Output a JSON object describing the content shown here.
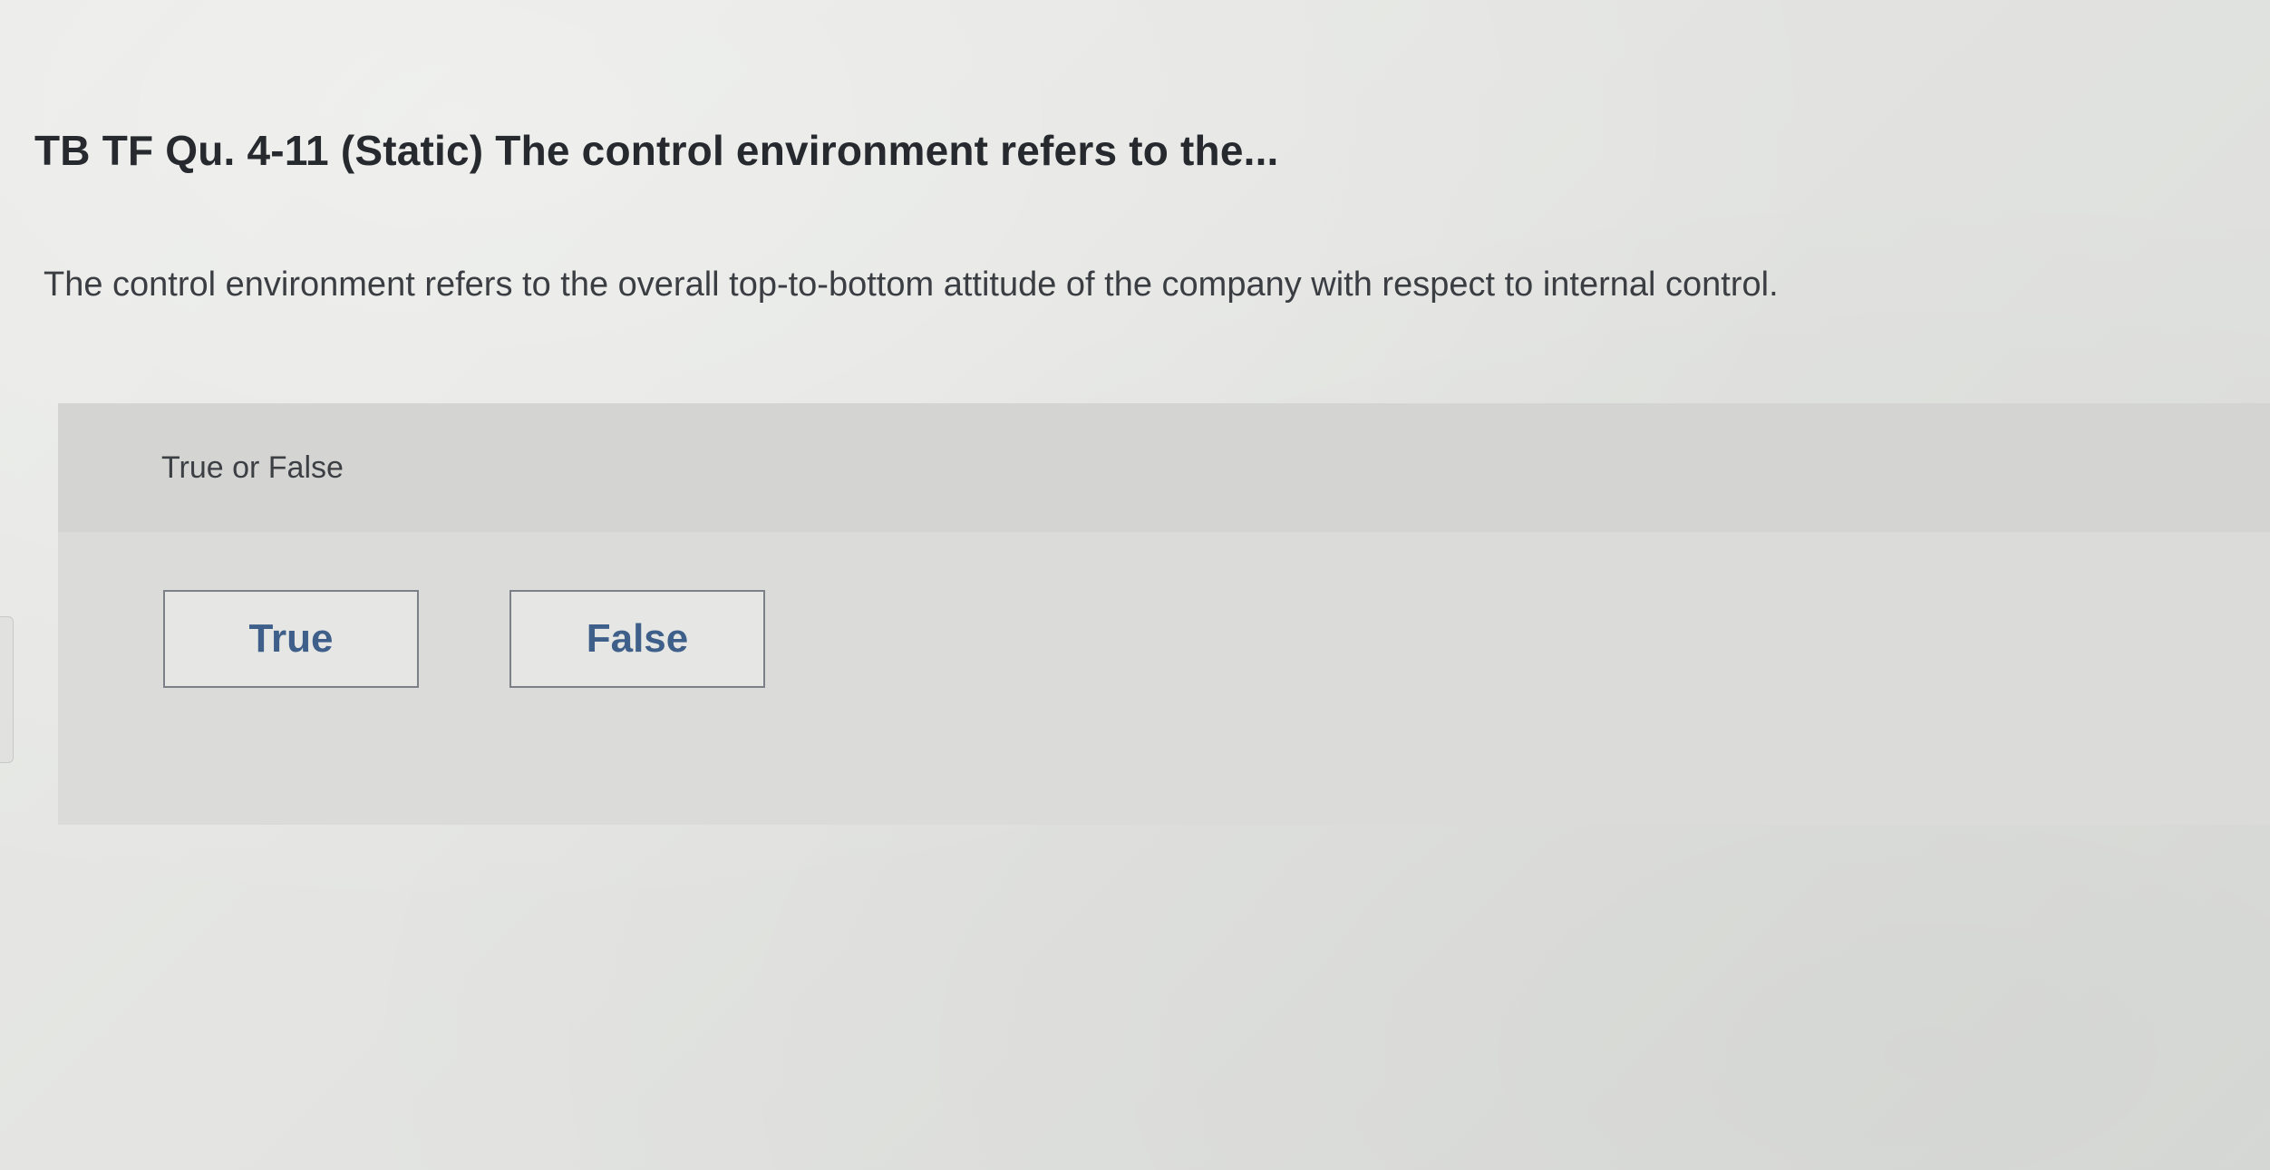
{
  "question": {
    "title": "TB TF Qu. 4-11 (Static) The control environment refers to the...",
    "statement": "The control environment refers to the overall top-to-bottom attitude of the company with respect to internal control."
  },
  "answer": {
    "prompt": "True or False",
    "options": [
      {
        "label": "True"
      },
      {
        "label": "False"
      }
    ]
  },
  "colors": {
    "background": "#e3e4e1",
    "panel": "#dbdcd9",
    "button_text": "#3e5f8a",
    "title_text": "#26292e"
  }
}
